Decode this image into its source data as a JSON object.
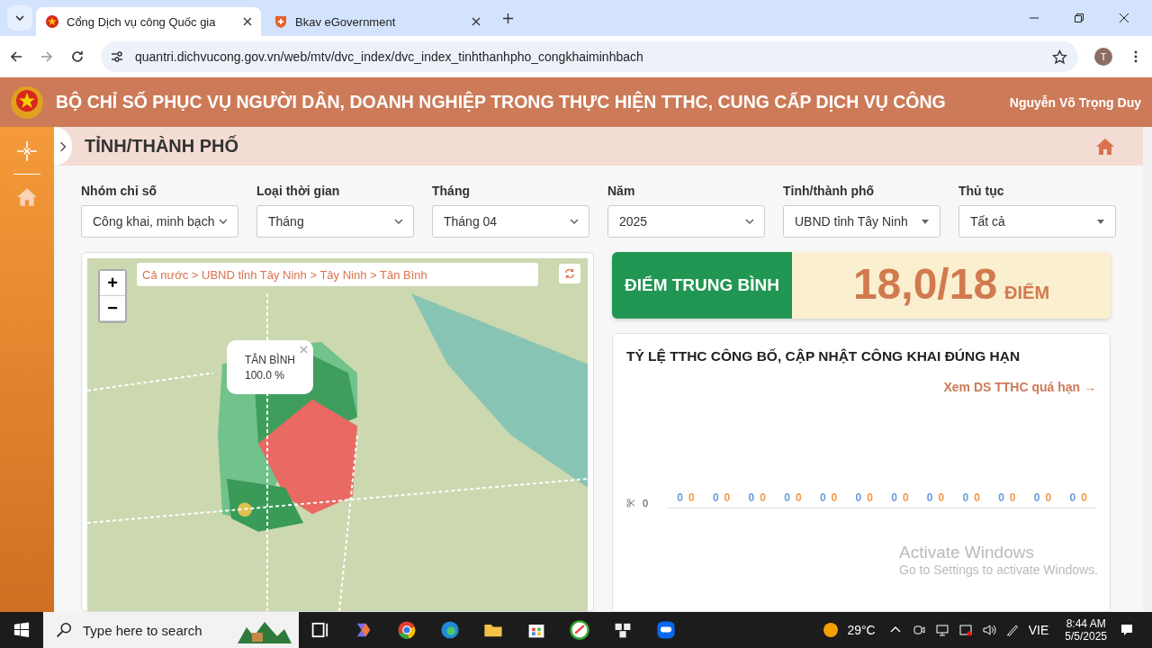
{
  "browser": {
    "tabs": [
      {
        "title": "Cổng Dịch vụ công Quốc gia",
        "selected": true
      },
      {
        "title": "Bkav eGovernment",
        "selected": false
      }
    ],
    "url": "quantri.dichvucong.gov.vn/web/mtv/dvc_index/dvc_index_tinhthanhpho_congkhaiminhbach",
    "profile": "T"
  },
  "header": {
    "title": "BỘ CHỈ SỐ PHỤC VỤ NGƯỜI DÂN, DOANH NGHIỆP TRONG THỰC HIỆN TTHC, CUNG CẤP DỊCH VỤ CÔNG",
    "user": "Nguyễn Võ Trọng Duy"
  },
  "page_title": "TỈNH/THÀNH PHỐ",
  "filters": [
    {
      "label": "Nhóm chỉ số",
      "value": "Công khai, minh bạch"
    },
    {
      "label": "Loại thời gian",
      "value": "Tháng"
    },
    {
      "label": "Tháng",
      "value": "Tháng 04"
    },
    {
      "label": "Năm",
      "value": "2025"
    },
    {
      "label": "Tỉnh/thành phố",
      "value": "UBND tỉnh Tây Ninh"
    },
    {
      "label": "Thủ tục",
      "value": "Tất cả"
    }
  ],
  "map": {
    "breadcrumb": "Cả nước > UBND tỉnh Tây Ninh > Tây Ninh > Tân Bình",
    "zoom_in": "+",
    "zoom_out": "−",
    "popup": {
      "name": "TÂN BÌNH",
      "value": "100.0 %"
    }
  },
  "score": {
    "label": "ĐIỂM TRUNG BÌNH",
    "value": "18,0/18",
    "unit": "ĐIỂM"
  },
  "rate_card": {
    "title": "TỶ LỆ TTHC CÔNG BỐ, CẬP NHẬT CÔNG KHAI ĐÚNG HẠN",
    "link": "Xem DS TTHC quá hạn →",
    "y_tick": "0",
    "groups": [
      {
        "a": "0",
        "b": "0"
      },
      {
        "a": "0",
        "b": "0"
      },
      {
        "a": "0",
        "b": "0"
      },
      {
        "a": "0",
        "b": "0"
      },
      {
        "a": "0",
        "b": "0"
      },
      {
        "a": "0",
        "b": "0"
      },
      {
        "a": "0",
        "b": "0"
      },
      {
        "a": "0",
        "b": "0"
      },
      {
        "a": "0",
        "b": "0"
      },
      {
        "a": "0",
        "b": "0"
      },
      {
        "a": "0",
        "b": "0"
      },
      {
        "a": "0",
        "b": "0"
      }
    ]
  },
  "activation": {
    "title": "Activate Windows",
    "text": "Go to Settings to activate Windows."
  },
  "taskbar": {
    "search": "Type here to search",
    "weather": "29°C",
    "language": "VIE",
    "time": "8:44 AM",
    "date": "5/5/2025"
  }
}
